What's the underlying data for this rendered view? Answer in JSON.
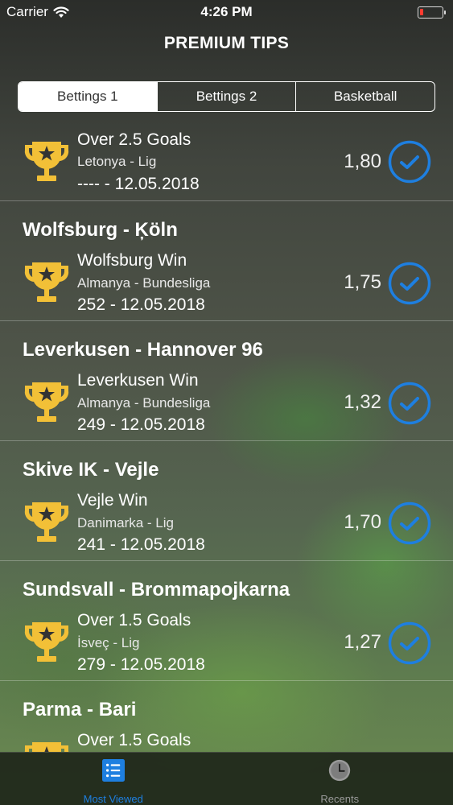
{
  "status_bar": {
    "carrier": "Carrier",
    "time": "4:26 PM"
  },
  "nav": {
    "title": "PREMIUM TIPS"
  },
  "segments": [
    {
      "label": "Bettings 1",
      "selected": true
    },
    {
      "label": "Bettings 2",
      "selected": false
    },
    {
      "label": "Basketball",
      "selected": false
    }
  ],
  "tips": [
    {
      "match": "",
      "tip": "Over 2.5 Goals",
      "league": "Letonya - Lig",
      "date": "---- - 12.05.2018",
      "odds": "1,80"
    },
    {
      "match": "Wolfsburg - Ķöln",
      "tip": "Wolfsburg Win",
      "league": "Almanya - Bundesliga",
      "date": "252 - 12.05.2018",
      "odds": "1,75"
    },
    {
      "match": "Leverkusen - Hannover 96",
      "tip": "Leverkusen Win",
      "league": "Almanya - Bundesliga",
      "date": "249 - 12.05.2018",
      "odds": "1,32"
    },
    {
      "match": "Skive IK - Vejle",
      "tip": "Vejle Win",
      "league": "Danimarka - Lig",
      "date": "241 - 12.05.2018",
      "odds": "1,70"
    },
    {
      "match": "Sundsvall - Brommapojkarna",
      "tip": "Over 1.5 Goals",
      "league": "İsveç - Lig",
      "date": "279 - 12.05.2018",
      "odds": "1,27"
    },
    {
      "match": "Parma - Bari",
      "tip": "Over 1.5 Goals",
      "league": "",
      "date": "",
      "odds": ""
    }
  ],
  "tab_bar": {
    "tabs": [
      {
        "label": "Most Viewed",
        "icon": "list-icon",
        "selected": true
      },
      {
        "label": "Recents",
        "icon": "clock-icon",
        "selected": false
      }
    ]
  },
  "colors": {
    "accent": "#1e7fe0",
    "trophy": "#f2c037",
    "battery_low": "#ff3b30"
  }
}
